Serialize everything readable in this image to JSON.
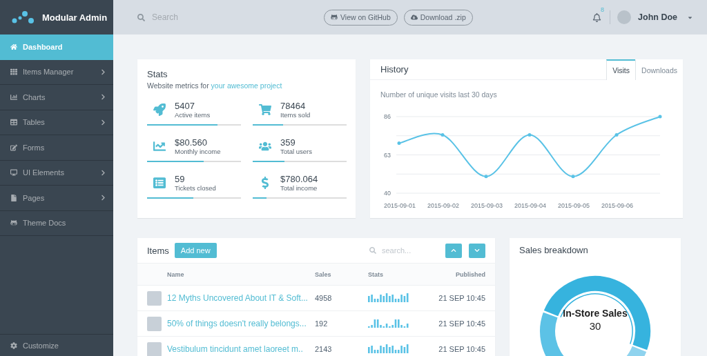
{
  "brand": {
    "name": "Modular Admin"
  },
  "sidebar": {
    "items": [
      {
        "label": "Dashboard",
        "selected": true,
        "expandable": false
      },
      {
        "label": "Items Manager",
        "selected": false,
        "expandable": true
      },
      {
        "label": "Charts",
        "selected": false,
        "expandable": true
      },
      {
        "label": "Tables",
        "selected": false,
        "expandable": true
      },
      {
        "label": "Forms",
        "selected": false,
        "expandable": false
      },
      {
        "label": "UI Elements",
        "selected": false,
        "expandable": true
      },
      {
        "label": "Pages",
        "selected": false,
        "expandable": true
      },
      {
        "label": "Theme Docs",
        "selected": false,
        "expandable": false
      }
    ],
    "footer": {
      "label": "Customize"
    }
  },
  "header": {
    "search": {
      "placeholder": "Search"
    },
    "buttons": [
      {
        "label": "View on GitHub",
        "kind": "github"
      },
      {
        "label": "Download .zip",
        "kind": "download"
      }
    ],
    "notifications": {
      "count": "8"
    },
    "user": {
      "name": "John Doe"
    }
  },
  "stats": {
    "title": "Stats",
    "subtitle": "Website metrics for",
    "link": "your awesome project",
    "items": [
      {
        "value": "5407",
        "label": "Active items",
        "level": 0.75
      },
      {
        "value": "78464",
        "label": "Items sold",
        "level": 0.32
      },
      {
        "value": "$80.560",
        "label": "Monthly income",
        "level": 0.6
      },
      {
        "value": "359",
        "label": "Total users",
        "level": 0.34
      },
      {
        "value": "59",
        "label": "Tickets closed",
        "level": 0.49
      },
      {
        "value": "$780.064",
        "label": "Total income",
        "level": 0.15
      }
    ]
  },
  "history": {
    "title": "History",
    "tabs": [
      {
        "label": "Visits",
        "selected": true
      },
      {
        "label": "Downloads",
        "selected": false
      }
    ],
    "subtitle": "Number of unique visits last 30 days",
    "chart_data": {
      "type": "line",
      "categories": [
        "2015-09-01",
        "2015-09-02",
        "2015-09-03",
        "2015-09-04",
        "2015-09-05",
        "2015-09-06",
        null
      ],
      "series": [
        {
          "color": "#59c2e6",
          "values": [
            70,
            75,
            50,
            75,
            50,
            75,
            86
          ]
        }
      ],
      "ylim": [
        40,
        86
      ],
      "yticks": [
        40,
        63,
        86
      ]
    }
  },
  "items": {
    "title": "Items",
    "add_button": "Add new",
    "search": {
      "placeholder": "search..."
    },
    "columns": [
      "Name",
      "Sales",
      "Stats",
      "Published"
    ],
    "rows": [
      {
        "name": "12 Myths Uncovered About IT & Soft...",
        "sales": "4958",
        "published": "21 SEP 10:45"
      },
      {
        "name": "50% of things doesn't really belongs...",
        "sales": "192",
        "published": "21 SEP 10:45"
      },
      {
        "name": "Vestibulum tincidunt amet laoreet m..",
        "sales": "2143",
        "published": "21 SEP 10:45"
      }
    ]
  },
  "sales": {
    "title": "Sales breakdown",
    "center_label": "In-Store Sales",
    "center_value": "30"
  }
}
